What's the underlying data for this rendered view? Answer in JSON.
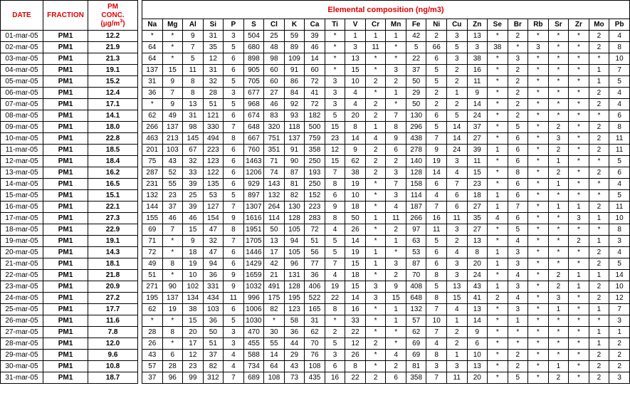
{
  "headers": {
    "date": "DATE",
    "fraction": "FRACTION",
    "pm_line1": "PM",
    "pm_line2": "CONC.",
    "pm_unit_pre": "(µg/m",
    "pm_unit_sup": "3",
    "pm_unit_post": ")",
    "elemental": "Elemental composition (ng/m3)"
  },
  "elements": [
    "Na",
    "Mg",
    "Al",
    "Si",
    "P",
    "S",
    "Cl",
    "K",
    "Ca",
    "Ti",
    "V",
    "Cr",
    "Mn",
    "Fe",
    "Ni",
    "Cu",
    "Zn",
    "Se",
    "Br",
    "Rb",
    "Sr",
    "Zr",
    "Mo",
    "Pb"
  ],
  "rows": [
    {
      "date": "01-mar-05",
      "fraction": "PM1",
      "pm": "12.2",
      "values": [
        "*",
        "*",
        "9",
        "31",
        "3",
        "504",
        "25",
        "59",
        "39",
        "*",
        "1",
        "1",
        "1",
        "42",
        "2",
        "3",
        "13",
        "*",
        "2",
        "*",
        "*",
        "*",
        "2",
        "4"
      ]
    },
    {
      "date": "02-mar-05",
      "fraction": "PM1",
      "pm": "21.9",
      "values": [
        "64",
        "*",
        "7",
        "35",
        "5",
        "680",
        "48",
        "89",
        "46",
        "*",
        "3",
        "11",
        "*",
        "5",
        "66",
        "5",
        "3",
        "38",
        "*",
        "3",
        "*",
        "*",
        "2",
        "8"
      ]
    },
    {
      "date": "03-mar-05",
      "fraction": "PM1",
      "pm": "21.3",
      "values": [
        "64",
        "*",
        "5",
        "12",
        "6",
        "898",
        "98",
        "109",
        "14",
        "*",
        "13",
        "*",
        "*",
        "22",
        "6",
        "3",
        "38",
        "*",
        "3",
        "*",
        "*",
        "*",
        "*",
        "10"
      ]
    },
    {
      "date": "04-mar-05",
      "fraction": "PM1",
      "pm": "19.1",
      "values": [
        "137",
        "15",
        "11",
        "31",
        "6",
        "905",
        "60",
        "91",
        "60",
        "*",
        "15",
        "*",
        "3",
        "37",
        "5",
        "2",
        "16",
        "*",
        "2",
        "*",
        "*",
        "*",
        "1",
        "7"
      ]
    },
    {
      "date": "05-mar-05",
      "fraction": "PM1",
      "pm": "15.2",
      "values": [
        "31",
        "9",
        "8",
        "32",
        "5",
        "705",
        "60",
        "86",
        "72",
        "3",
        "10",
        "2",
        "2",
        "50",
        "5",
        "2",
        "11",
        "*",
        "2",
        "*",
        "*",
        "*",
        "1",
        "5"
      ]
    },
    {
      "date": "06-mar-05",
      "fraction": "PM1",
      "pm": "12.4",
      "values": [
        "36",
        "7",
        "8",
        "28",
        "3",
        "677",
        "27",
        "84",
        "41",
        "3",
        "4",
        "*",
        "1",
        "29",
        "2",
        "1",
        "9",
        "*",
        "2",
        "*",
        "*",
        "*",
        "2",
        "4"
      ]
    },
    {
      "date": "07-mar-05",
      "fraction": "PM1",
      "pm": "17.1",
      "values": [
        "*",
        "9",
        "13",
        "51",
        "5",
        "968",
        "46",
        "92",
        "72",
        "3",
        "4",
        "2",
        "*",
        "50",
        "2",
        "2",
        "14",
        "*",
        "2",
        "*",
        "*",
        "*",
        "2",
        "4"
      ]
    },
    {
      "date": "08-mar-05",
      "fraction": "PM1",
      "pm": "14.1",
      "values": [
        "62",
        "49",
        "31",
        "121",
        "6",
        "674",
        "83",
        "93",
        "182",
        "5",
        "20",
        "2",
        "7",
        "130",
        "6",
        "5",
        "24",
        "*",
        "2",
        "*",
        "*",
        "*",
        "*",
        "6"
      ]
    },
    {
      "date": "09-mar-05",
      "fraction": "PM1",
      "pm": "18.0",
      "values": [
        "266",
        "137",
        "98",
        "330",
        "7",
        "648",
        "320",
        "118",
        "500",
        "15",
        "8",
        "1",
        "8",
        "296",
        "5",
        "14",
        "37",
        "*",
        "5",
        "*",
        "2",
        "*",
        "2",
        "8"
      ]
    },
    {
      "date": "10-mar-05",
      "fraction": "PM1",
      "pm": "22.8",
      "values": [
        "463",
        "213",
        "145",
        "494",
        "8",
        "667",
        "751",
        "137",
        "759",
        "23",
        "14",
        "4",
        "9",
        "438",
        "7",
        "14",
        "27",
        "*",
        "6",
        "*",
        "3",
        "*",
        "2",
        "11"
      ]
    },
    {
      "date": "11-mar-05",
      "fraction": "PM1",
      "pm": "18.5",
      "values": [
        "201",
        "103",
        "67",
        "223",
        "6",
        "760",
        "351",
        "91",
        "358",
        "12",
        "9",
        "2",
        "6",
        "278",
        "9",
        "24",
        "39",
        "1",
        "6",
        "*",
        "2",
        "*",
        "2",
        "11"
      ]
    },
    {
      "date": "12-mar-05",
      "fraction": "PM1",
      "pm": "18.4",
      "values": [
        "75",
        "43",
        "32",
        "123",
        "6",
        "1463",
        "71",
        "90",
        "250",
        "15",
        "62",
        "2",
        "2",
        "140",
        "19",
        "3",
        "11",
        "*",
        "6",
        "*",
        "1",
        "*",
        "*",
        "5"
      ]
    },
    {
      "date": "13-mar-05",
      "fraction": "PM1",
      "pm": "16.2",
      "values": [
        "287",
        "52",
        "33",
        "122",
        "6",
        "1206",
        "74",
        "87",
        "193",
        "7",
        "38",
        "2",
        "3",
        "128",
        "14",
        "4",
        "15",
        "*",
        "8",
        "*",
        "2",
        "*",
        "2",
        "6"
      ]
    },
    {
      "date": "14-mar-05",
      "fraction": "PM1",
      "pm": "16.5",
      "values": [
        "231",
        "55",
        "39",
        "135",
        "6",
        "929",
        "143",
        "81",
        "250",
        "8",
        "19",
        "*",
        "7",
        "158",
        "6",
        "7",
        "23",
        "*",
        "6",
        "*",
        "1",
        "*",
        "*",
        "4"
      ]
    },
    {
      "date": "15-mar-05",
      "fraction": "PM1",
      "pm": "15.1",
      "values": [
        "132",
        "23",
        "25",
        "53",
        "5",
        "897",
        "132",
        "82",
        "152",
        "6",
        "10",
        "*",
        "3",
        "114",
        "4",
        "6",
        "18",
        "1",
        "6",
        "*",
        "*",
        "*",
        "*",
        "5"
      ]
    },
    {
      "date": "16-mar-05",
      "fraction": "PM1",
      "pm": "22.1",
      "values": [
        "144",
        "37",
        "39",
        "127",
        "7",
        "1307",
        "264",
        "130",
        "223",
        "9",
        "18",
        "*",
        "4",
        "187",
        "7",
        "6",
        "27",
        "1",
        "7",
        "*",
        "1",
        "1",
        "2",
        "11"
      ]
    },
    {
      "date": "17-mar-05",
      "fraction": "PM1",
      "pm": "27.3",
      "values": [
        "155",
        "46",
        "46",
        "154",
        "9",
        "1616",
        "114",
        "128",
        "283",
        "8",
        "50",
        "1",
        "11",
        "266",
        "16",
        "11",
        "35",
        "4",
        "6",
        "*",
        "*",
        "3",
        "1",
        "10"
      ]
    },
    {
      "date": "18-mar-05",
      "fraction": "PM1",
      "pm": "22.9",
      "values": [
        "69",
        "7",
        "15",
        "47",
        "8",
        "1951",
        "50",
        "105",
        "72",
        "4",
        "26",
        "*",
        "2",
        "97",
        "11",
        "3",
        "27",
        "*",
        "5",
        "*",
        "*",
        "*",
        "*",
        "8"
      ]
    },
    {
      "date": "19-mar-05",
      "fraction": "PM1",
      "pm": "19.1",
      "values": [
        "71",
        "*",
        "9",
        "32",
        "7",
        "1705",
        "13",
        "94",
        "51",
        "5",
        "14",
        "*",
        "1",
        "63",
        "5",
        "2",
        "13",
        "*",
        "4",
        "*",
        "*",
        "2",
        "1",
        "3"
      ]
    },
    {
      "date": "20-mar-05",
      "fraction": "PM1",
      "pm": "14.3",
      "values": [
        "72",
        "*",
        "18",
        "47",
        "6",
        "1446",
        "17",
        "105",
        "56",
        "5",
        "19",
        "1",
        "*",
        "53",
        "6",
        "4",
        "8",
        "1",
        "3",
        "*",
        "*",
        "*",
        "2",
        "4"
      ]
    },
    {
      "date": "21-mar-05",
      "fraction": "PM1",
      "pm": "18.1",
      "values": [
        "49",
        "8",
        "19",
        "94",
        "6",
        "1429",
        "42",
        "96",
        "77",
        "7",
        "15",
        "1",
        "3",
        "87",
        "6",
        "3",
        "20",
        "1",
        "3",
        "*",
        "*",
        "*",
        "2",
        "5"
      ]
    },
    {
      "date": "22-mar-05",
      "fraction": "PM1",
      "pm": "21.8",
      "values": [
        "51",
        "*",
        "10",
        "36",
        "9",
        "1659",
        "21",
        "131",
        "36",
        "4",
        "18",
        "*",
        "2",
        "70",
        "8",
        "3",
        "24",
        "*",
        "4",
        "*",
        "2",
        "1",
        "1",
        "14"
      ]
    },
    {
      "date": "23-mar-05",
      "fraction": "PM1",
      "pm": "20.9",
      "values": [
        "271",
        "90",
        "102",
        "331",
        "9",
        "1032",
        "491",
        "128",
        "406",
        "19",
        "15",
        "3",
        "9",
        "408",
        "5",
        "13",
        "43",
        "1",
        "3",
        "*",
        "2",
        "1",
        "2",
        "10"
      ]
    },
    {
      "date": "24-mar-05",
      "fraction": "PM1",
      "pm": "27.2",
      "values": [
        "195",
        "137",
        "134",
        "434",
        "11",
        "996",
        "175",
        "195",
        "522",
        "22",
        "14",
        "3",
        "15",
        "648",
        "8",
        "15",
        "41",
        "2",
        "4",
        "*",
        "3",
        "*",
        "2",
        "12"
      ]
    },
    {
      "date": "25-mar-05",
      "fraction": "PM1",
      "pm": "17.7",
      "values": [
        "62",
        "19",
        "38",
        "103",
        "6",
        "1006",
        "82",
        "123",
        "165",
        "8",
        "16",
        "*",
        "1",
        "132",
        "7",
        "4",
        "13",
        "*",
        "3",
        "*",
        "1",
        "*",
        "1",
        "7"
      ]
    },
    {
      "date": "26-mar-05",
      "fraction": "PM1",
      "pm": "11.6",
      "values": [
        "*",
        "*",
        "15",
        "36",
        "5",
        "1030",
        "*",
        "58",
        "31",
        "*",
        "33",
        "*",
        "1",
        "57",
        "10",
        "1",
        "14",
        "*",
        "1",
        "*",
        "*",
        "*",
        "*",
        "3"
      ]
    },
    {
      "date": "27-mar-05",
      "fraction": "PM1",
      "pm": "7.8",
      "values": [
        "28",
        "8",
        "20",
        "50",
        "3",
        "470",
        "30",
        "36",
        "62",
        "2",
        "22",
        "*",
        "*",
        "62",
        "7",
        "2",
        "9",
        "*",
        "*",
        "*",
        "*",
        "*",
        "1",
        "1"
      ]
    },
    {
      "date": "28-mar-05",
      "fraction": "PM1",
      "pm": "12.0",
      "values": [
        "26",
        "*",
        "17",
        "51",
        "3",
        "455",
        "55",
        "44",
        "70",
        "5",
        "12",
        "2",
        "*",
        "69",
        "4",
        "2",
        "6",
        "*",
        "*",
        "*",
        "*",
        "*",
        "1",
        "2"
      ]
    },
    {
      "date": "29-mar-05",
      "fraction": "PM1",
      "pm": "9.6",
      "values": [
        "43",
        "6",
        "12",
        "37",
        "4",
        "588",
        "14",
        "29",
        "76",
        "3",
        "26",
        "*",
        "4",
        "69",
        "8",
        "1",
        "10",
        "*",
        "2",
        "*",
        "*",
        "*",
        "2",
        "2"
      ]
    },
    {
      "date": "30-mar-05",
      "fraction": "PM1",
      "pm": "10.8",
      "values": [
        "57",
        "28",
        "23",
        "82",
        "4",
        "734",
        "64",
        "43",
        "108",
        "6",
        "8",
        "*",
        "2",
        "81",
        "3",
        "3",
        "13",
        "*",
        "2",
        "*",
        "1",
        "*",
        "2",
        "2"
      ]
    },
    {
      "date": "31-mar-05",
      "fraction": "PM1",
      "pm": "18.7",
      "values": [
        "37",
        "96",
        "99",
        "312",
        "7",
        "689",
        "108",
        "73",
        "435",
        "16",
        "22",
        "2",
        "6",
        "358",
        "7",
        "11",
        "20",
        "*",
        "5",
        "*",
        "2",
        "*",
        "2",
        "3"
      ]
    }
  ]
}
